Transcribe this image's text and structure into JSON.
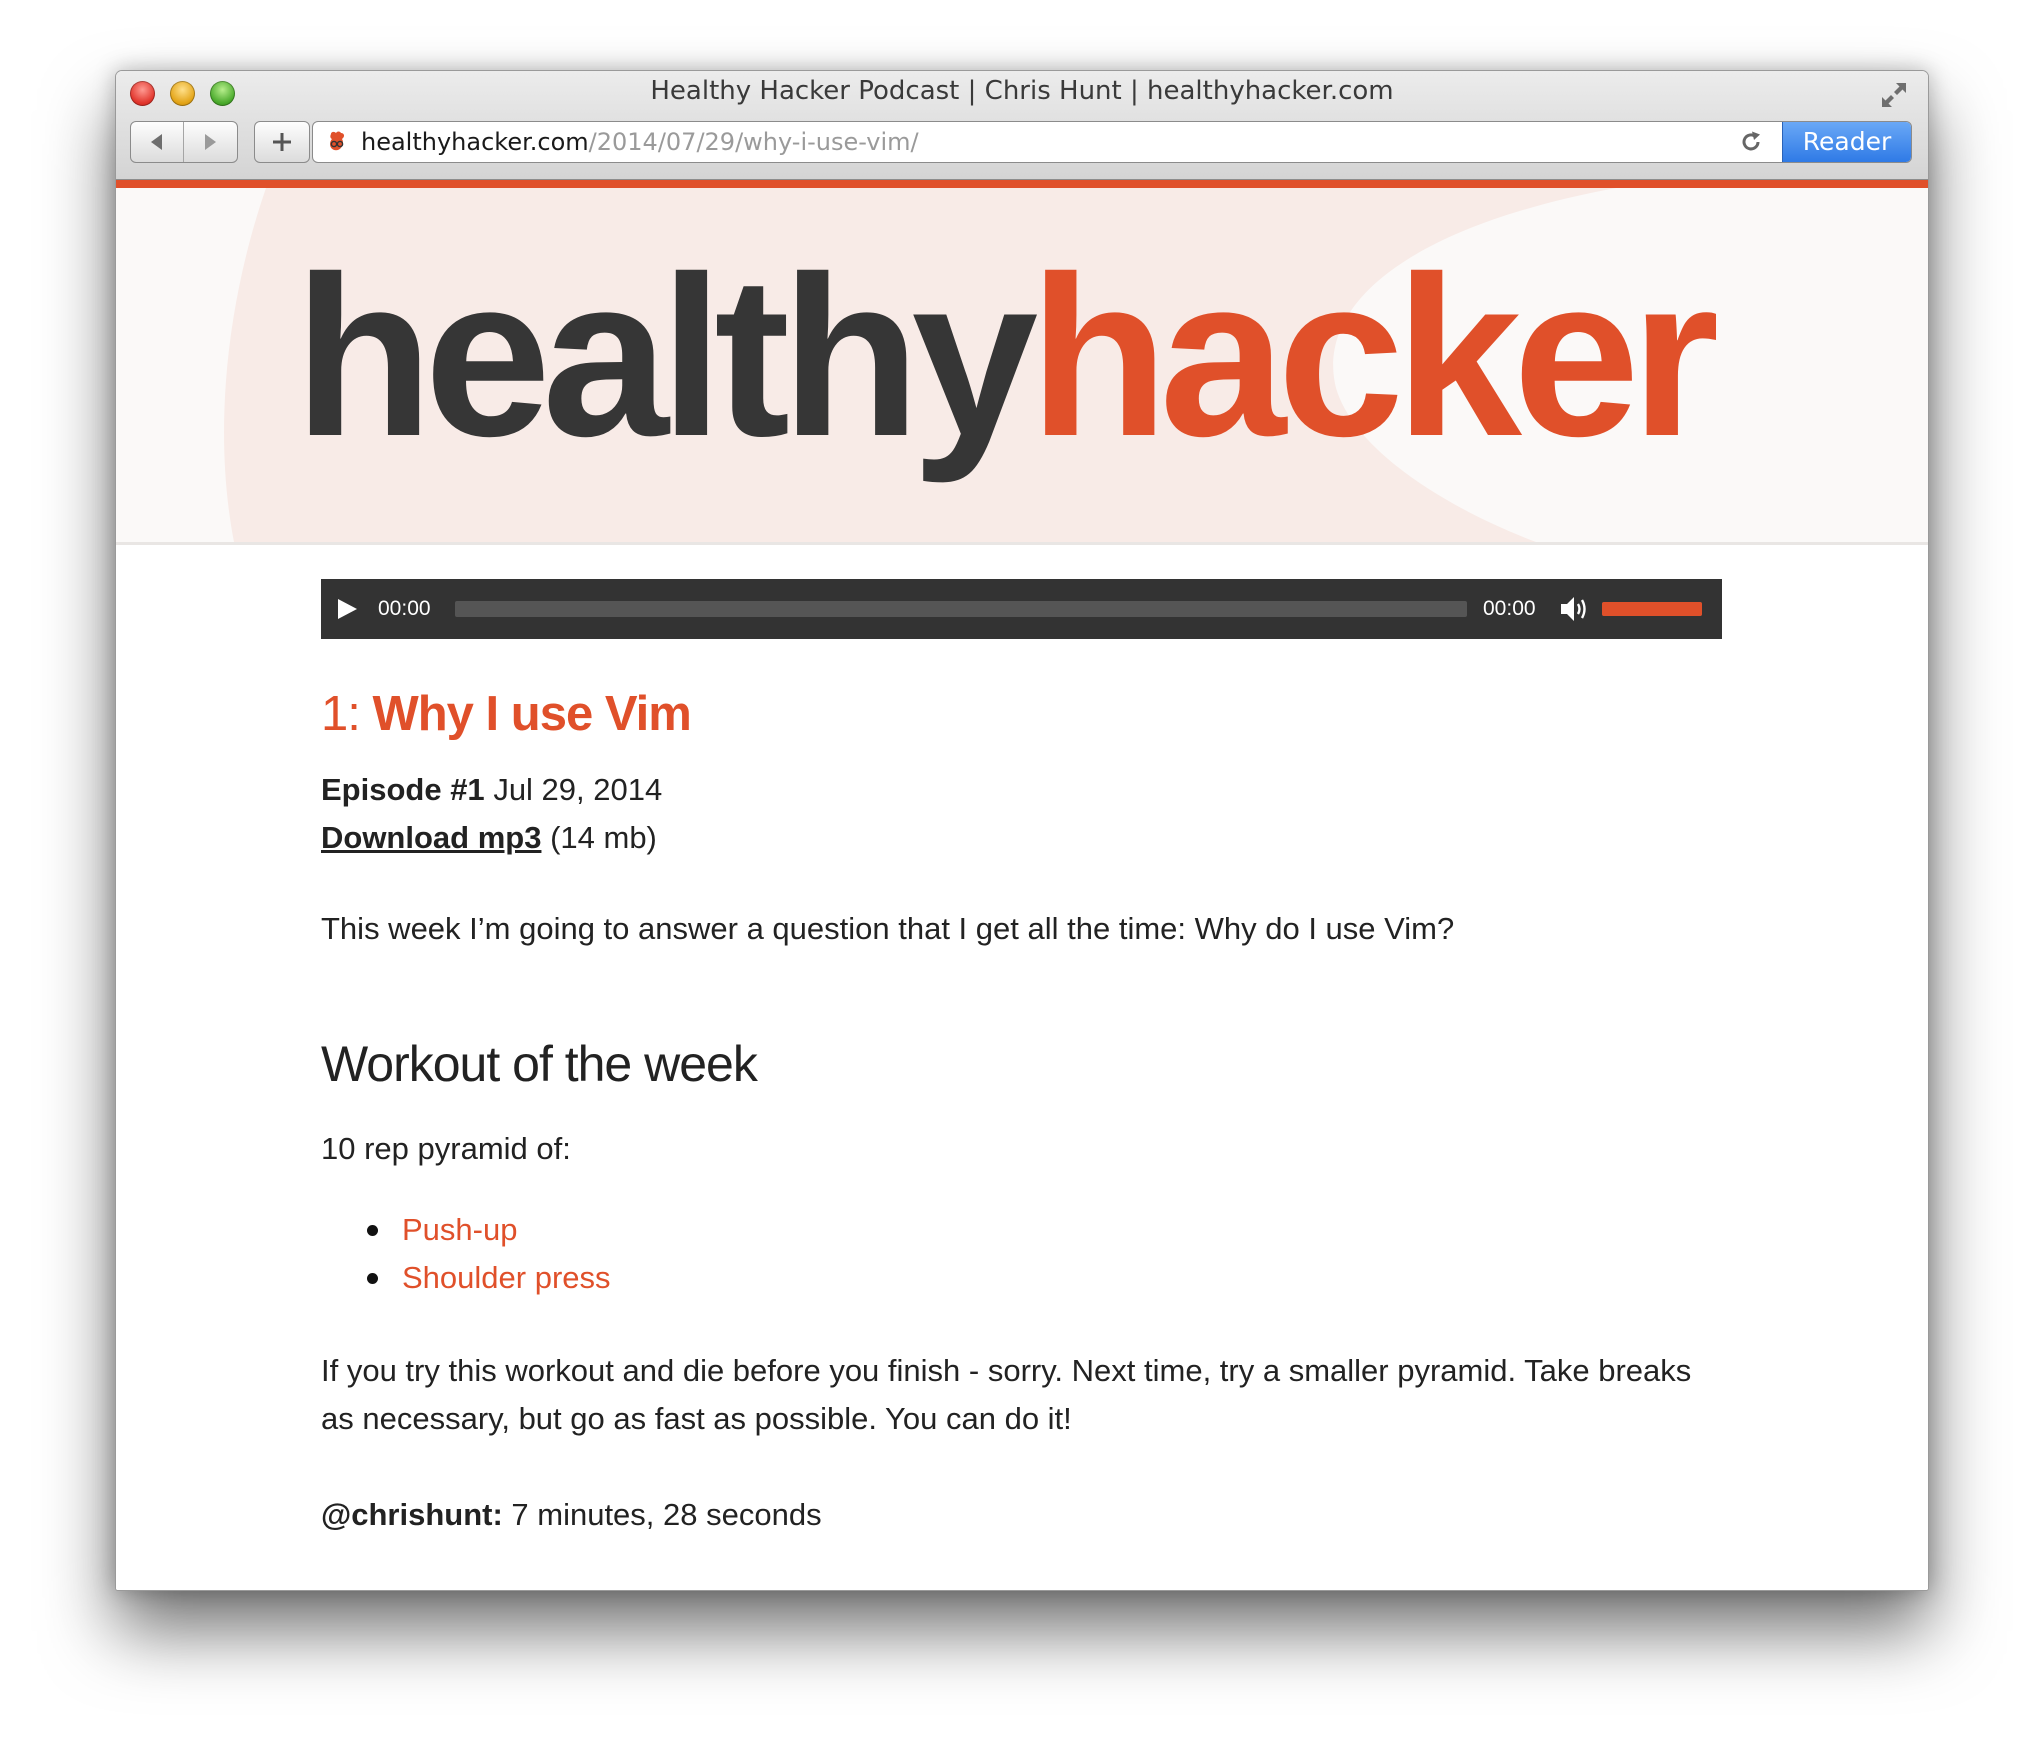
{
  "window": {
    "title": "Healthy Hacker Podcast | Chris Hunt | healthyhacker.com"
  },
  "toolbar": {
    "back_icon": "back-arrow-icon",
    "forward_icon": "forward-arrow-icon",
    "new_tab_label": "+",
    "url_domain": "healthyhacker.com",
    "url_path": "/2014/07/29/why-i-use-vim/",
    "reader_label": "Reader",
    "reload_icon": "reload-icon"
  },
  "colors": {
    "accent": "#e0502a",
    "logo_dark": "#363636",
    "player_bg": "#333333",
    "reader_blue": "#3a84ec"
  },
  "site": {
    "logo_part1": "healthy",
    "logo_part2": "hacker"
  },
  "player": {
    "current_time": "00:00",
    "total_time": "00:00",
    "progress": 0,
    "volume": 1.0
  },
  "post": {
    "number": "1:",
    "title": "Why I use Vim",
    "episode_label": "Episode #1",
    "date": "Jul 29, 2014",
    "download_label": "Download mp3",
    "download_size": "(14 mb)",
    "intro": "This week I’m going to answer a question that I get all the time: Why do I use Vim?",
    "workout_heading": "Workout of the week",
    "pyramid_text": "10 rep pyramid of:",
    "exercises": [
      "Push-up",
      "Shoulder press"
    ],
    "advice": "If you try this workout and die before you finish - sorry. Next time, try a smaller pyramid. Take breaks as necessary, but go as fast as possible. You can do it!",
    "time_handle": "@chrishunt:",
    "time_value": " 7 minutes, 28 seconds"
  }
}
